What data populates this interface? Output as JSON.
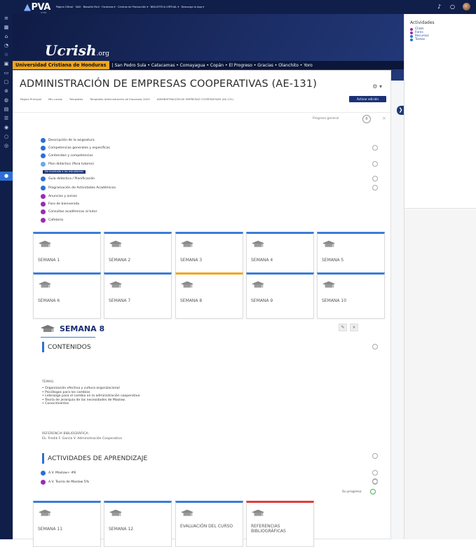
{
  "topbar": {
    "logo": "PVA",
    "logo_sub": "UCEN",
    "nav": "Página Oficial · SAD · Biosofía Fácil · Foráneos ▾ · Centros de Producción ▾ · BIBLIOTECA VIRTUAL ▾ · Descarga la App ▾",
    "bell_icon": "bell-icon",
    "chat_icon": "chat-icon"
  },
  "sidebar": {
    "items": [
      "≡",
      "▦",
      "⌂",
      "◔",
      "☆",
      "▣",
      "▭",
      "▢",
      "⊚",
      "◍",
      "▤",
      "☰",
      "◉",
      "○",
      "◎"
    ],
    "active_item": "●"
  },
  "banner": {
    "logo": "Ucrish",
    "logo_suffix": ".org",
    "university": "Universidad Cristiana de Honduras",
    "cities": "| San Pedro Sula • Catacamas • Comayagua • Copán • El Progreso • Gracias • Olanchito • Yoro"
  },
  "course": {
    "title": "ADMINISTRACIÓN DE EMPRESAS COOPERATIVAS (AE-131)",
    "breadcrumbs": [
      "Página Principal",
      "Mis cursos",
      "Templates",
      "Templates Administración de Empresas 2020",
      "ADMINISTRACIÓN DE EMPRESAS COOPERATIVAS (AE-131)"
    ],
    "edit_button": "Activar edición",
    "progress_label": "Progreso general",
    "progress_value": "0",
    "close": "×"
  },
  "activities": [
    {
      "label": "Descripción de la asignatura",
      "color": "#2d6fd6",
      "check": false
    },
    {
      "label": "Competencias generales y específicas",
      "color": "#2d6fd6",
      "check": true
    },
    {
      "label": "Contenidos y competencias",
      "color": "#2d6fd6",
      "check": false
    },
    {
      "label": "Plan didáctico (Para tutores)",
      "color": "#6aa9e9",
      "check": true
    },
    {
      "label": "Guía didáctica / Planificación",
      "color": "#2d6fd6",
      "check": true
    },
    {
      "label": "Programación de Actividades Académicas",
      "color": "#2d6fd6",
      "check": true
    },
    {
      "label": "Anuncios y avisos",
      "color": "#9b2bb3",
      "check": false
    },
    {
      "label": "Foro de bienvenida",
      "color": "#9b2bb3",
      "check": false
    },
    {
      "label": "Consultas académicas al tutor",
      "color": "#9b2bb3",
      "check": false
    },
    {
      "label": "Cafetería",
      "color": "#9b2bb3",
      "check": false
    }
  ],
  "restricted_badge": "No mostrado a los estudiantes",
  "weeks_row1": [
    "SEMANA 1",
    "SEMANA 2",
    "SEMANA 3",
    "SEMANA 4",
    "SEMANA 5"
  ],
  "weeks_row2": [
    "SEMANA 6",
    "SEMANA 7",
    "SEMANA 8",
    "SEMANA 9",
    "SEMANA 10"
  ],
  "weeks_row3": [
    "SEMANA 11",
    "SEMANA 12",
    "EVALUACIÓN DEL CURSO",
    "REFERENCIAS BIBLIOGRÁFICAS"
  ],
  "section": {
    "title": "SEMANA 8",
    "edit_icon": "✎",
    "close_icon": "×",
    "contenidos": "CONTENIDOS",
    "temas_title": "TEMAS:",
    "temas": [
      "Organización efectiva y cultura organizacional",
      "Psicólogos para los cambios",
      "Liderazgo para el cambio en la administración cooperativa",
      "Teoría de jerarquía de las necesidades de Maslow.",
      "Conocimientos"
    ],
    "ref_title": "REFERENCIA BIBLIOGRÁFICA:",
    "ref_text": "Ek. Fredik F. García V. Administración Cooperativa",
    "actividades": "ACTIVIDADES DE APRENDIZAJE",
    "tasks": [
      {
        "label": "A.V. Maslow+ #8",
        "color": "#2d6fd6"
      },
      {
        "label": "A.V. Teoría de Maslow 5%",
        "color": "#9b2bb3"
      }
    ],
    "your_progress": "Su progreso"
  },
  "right_panel": {
    "title": "Actividades",
    "links": [
      {
        "label": "Chats",
        "color": "#9b2bb3"
      },
      {
        "label": "Foros",
        "color": "#9b2bb3"
      },
      {
        "label": "Recursos",
        "color": "#2d6fd6"
      },
      {
        "label": "Tareas",
        "color": "#2d6fd6"
      }
    ]
  }
}
